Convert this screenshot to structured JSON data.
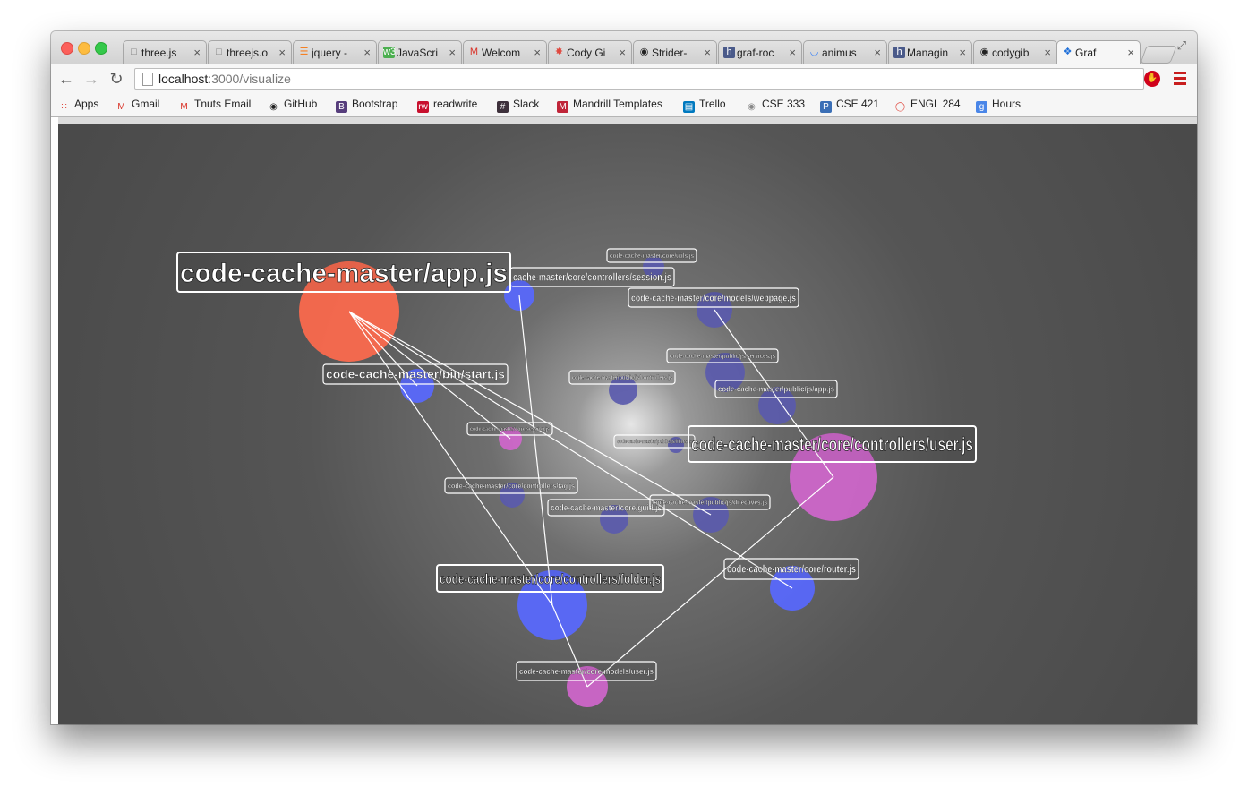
{
  "tabs": [
    {
      "label": "three.js",
      "icon": "page-icon"
    },
    {
      "label": "threejs.o",
      "icon": "page-icon"
    },
    {
      "label": "jquery -",
      "icon": "stackoverflow-icon"
    },
    {
      "label": "JavaScri",
      "icon": "w3schools-icon"
    },
    {
      "label": "Welcom",
      "icon": "gmail-icon"
    },
    {
      "label": "Cody Gi",
      "icon": "pinwheel-icon"
    },
    {
      "label": "Strider-",
      "icon": "github-icon"
    },
    {
      "label": "graf-roc",
      "icon": "h-icon"
    },
    {
      "label": "animus",
      "icon": "loading-icon"
    },
    {
      "label": "Managin",
      "icon": "h-icon"
    },
    {
      "label": "codygib",
      "icon": "github-icon"
    },
    {
      "label": "Graf",
      "icon": "graf-icon"
    }
  ],
  "address": {
    "host": "localhost",
    "path": ":3000/visualize"
  },
  "bookmarks": [
    {
      "label": "Apps",
      "icon": "apps-icon",
      "color": "#e0483e"
    },
    {
      "label": "Gmail",
      "icon": "gmail-icon",
      "color": "#d93025"
    },
    {
      "label": "Tnuts Email",
      "icon": "gmail-icon",
      "color": "#d93025"
    },
    {
      "label": "GitHub",
      "icon": "github-icon",
      "color": "#222222"
    },
    {
      "label": "Bootstrap",
      "icon": "bootstrap-icon",
      "color": "#563d7c"
    },
    {
      "label": "readwrite",
      "icon": "readwrite-icon",
      "color": "#c8102e"
    },
    {
      "label": "Slack",
      "icon": "slack-icon",
      "color": "#3e313c"
    },
    {
      "label": "Mandrill Templates",
      "icon": "mandrill-icon",
      "color": "#c02539"
    },
    {
      "label": "Trello",
      "icon": "trello-icon",
      "color": "#0079bf"
    },
    {
      "label": "CSE 333",
      "icon": "globe-icon",
      "color": "#888888"
    },
    {
      "label": "CSE 421",
      "icon": "p-icon",
      "color": "#3b6fb6"
    },
    {
      "label": "ENGL 284",
      "icon": "ring-icon",
      "color": "#e0483e"
    },
    {
      "label": "Hours",
      "icon": "google-docs-icon",
      "color": "#4a86e8"
    }
  ],
  "graph": {
    "colors": {
      "app": "#ff6a4d",
      "blue": "#5868ff",
      "purple": "#5a5aad",
      "pink": "#d066cc",
      "edge": "#ffffff"
    },
    "nodes": [
      {
        "id": "app",
        "label": "code-cache-master/app.js",
        "color": "app"
      },
      {
        "id": "session",
        "label": "cache-master/core/controllers/session.js",
        "color": "blue"
      },
      {
        "id": "utils",
        "label": "code-cache-master/core/utils.js",
        "color": "purple"
      },
      {
        "id": "webpage",
        "label": "code-cache-master/core/models/webpage.js",
        "color": "purple"
      },
      {
        "id": "start",
        "label": "code-cache-master/bin/start.js",
        "color": "blue"
      },
      {
        "id": "services",
        "label": "code-cache-master/public/js/services.js",
        "color": "purple"
      },
      {
        "id": "pubcontrollers",
        "label": "code-cache-master/public/js/controllers.js",
        "color": "purple"
      },
      {
        "id": "pubapp",
        "label": "code-cache-master/public/js/app.js",
        "color": "purple"
      },
      {
        "id": "session2",
        "label": "code-cache-master/core/session.js",
        "color": "pink"
      },
      {
        "id": "filters",
        "label": "code-cache-master/public/js/filters.js",
        "color": "purple"
      },
      {
        "id": "user",
        "label": "code-cache-master/core/controllers/user.js",
        "color": "pink"
      },
      {
        "id": "tag",
        "label": "code-cache-master/core/controllers/tag.js",
        "color": "purple"
      },
      {
        "id": "guid",
        "label": "code-cache-master/core/guid.js",
        "color": "purple"
      },
      {
        "id": "directives",
        "label": "code-cache-master/public/js/directives.js",
        "color": "purple"
      },
      {
        "id": "folder",
        "label": "code-cache-master/core/controllers/folder.js",
        "color": "blue"
      },
      {
        "id": "router",
        "label": "code-cache-master/core/router.js",
        "color": "blue"
      },
      {
        "id": "usermodel",
        "label": "code-cache-master/core/models/user.js",
        "color": "pink"
      }
    ],
    "edges": [
      [
        "app",
        "start"
      ],
      [
        "app",
        "session2"
      ],
      [
        "app",
        "directives"
      ],
      [
        "app",
        "router"
      ],
      [
        "app",
        "folder"
      ],
      [
        "session",
        "folder"
      ],
      [
        "webpage",
        "user"
      ],
      [
        "folder",
        "usermodel"
      ],
      [
        "user",
        "usermodel"
      ]
    ]
  }
}
